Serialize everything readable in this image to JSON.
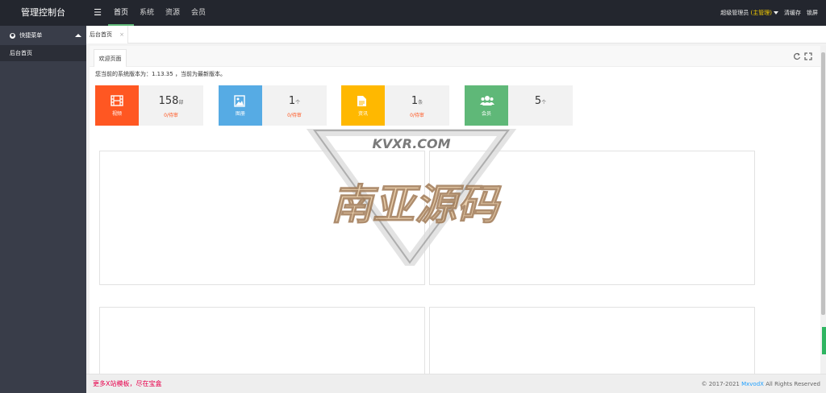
{
  "header": {
    "brand": "管理控制台",
    "menu_icon": "list-icon",
    "nav": [
      {
        "label": "首页",
        "active": true
      },
      {
        "label": "系统",
        "active": false
      },
      {
        "label": "资源",
        "active": false
      },
      {
        "label": "会员",
        "active": false
      }
    ],
    "user": "超级管理员",
    "role": "(主管理)",
    "clear_cache": "清缓存",
    "lock_screen": "锁屏"
  },
  "sidebar": {
    "section_title": "快捷菜单",
    "items": [
      {
        "label": "后台首页"
      }
    ]
  },
  "tabs": [
    {
      "label": "后台首页",
      "close": "×"
    }
  ],
  "panel": {
    "tab": "欢迎页面",
    "version_text": "您当前的系统版本为：1.13.35 ，当前为最新版本。",
    "controls": [
      "refresh-icon",
      "fullscreen-icon"
    ]
  },
  "cards": [
    {
      "icon": "film-icon",
      "label": "视频",
      "count": "158",
      "unit": "部",
      "pending": "0/待审",
      "color": "#ff5722"
    },
    {
      "icon": "image-icon",
      "label": "图册",
      "count": "1",
      "unit": "个",
      "pending": "0/待审",
      "color": "#56abe4"
    },
    {
      "icon": "document-icon",
      "label": "资讯",
      "count": "1",
      "unit": "条",
      "pending": "0/待审",
      "color": "#ffb800"
    },
    {
      "icon": "users-icon",
      "label": "会员",
      "count": "5",
      "unit": "个",
      "pending": "",
      "color": "#5fb878"
    }
  ],
  "watermark": {
    "top": "KVXR.COM",
    "main": "南亚源码"
  },
  "footer": {
    "left": "更多X站模板，尽在宝盒",
    "copyright": "© 2017-2021",
    "brand": "MxvodX",
    "rights": "All Rights Reserved"
  }
}
